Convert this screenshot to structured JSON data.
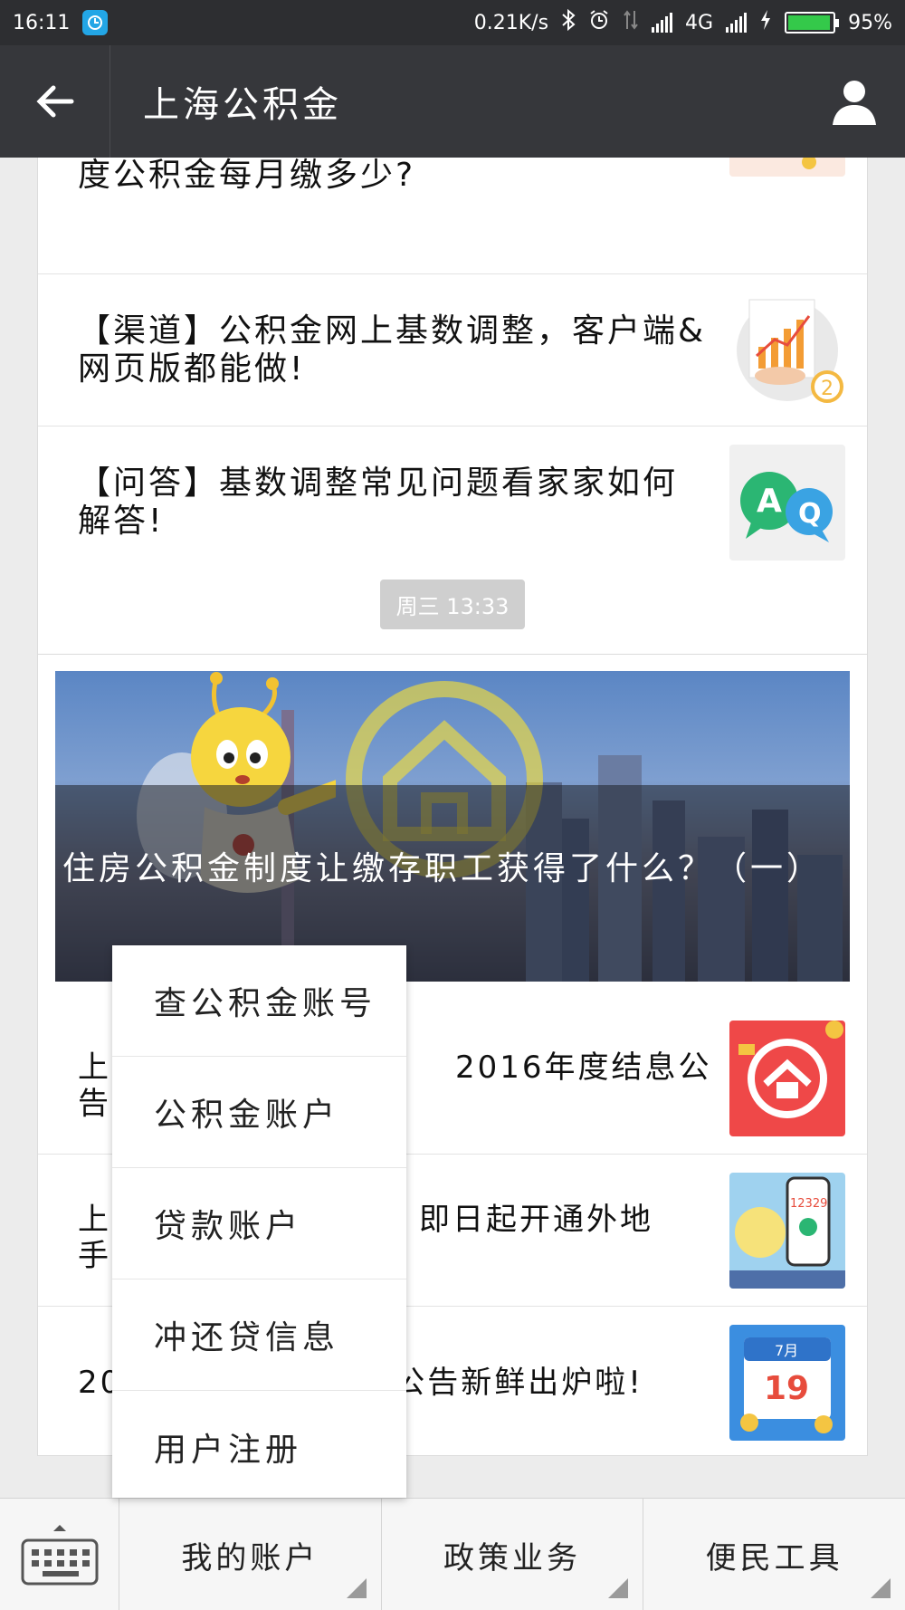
{
  "status_bar": {
    "time": "16:11",
    "network_speed": "0.21K/s",
    "network_type": "4G",
    "battery_percent": "95%",
    "battery_level": 0.95
  },
  "header": {
    "title": "上海公积金",
    "back_icon": "arrow-left-icon",
    "profile_icon": "user-icon"
  },
  "articles_top": [
    {
      "title": "度公积金每月缴多少?",
      "thumb_icon": "money-bag-icon"
    },
    {
      "title": "【渠道】公积金网上基数调整，客户端&网页版都能做!",
      "thumb_icon": "chart-icon",
      "badge": "2"
    },
    {
      "title": "【问答】基数调整常见问题看家家如何解答!",
      "thumb_icon": "qa-icon",
      "thumb_a": "A",
      "thumb_q": "Q"
    }
  ],
  "timestamp": "周三 13:33",
  "hero": {
    "title": "住房公积金制度让缴存职工获得了什么？（一）"
  },
  "articles_bottom": [
    {
      "title_left": "上",
      "title_right": "2016年度结息公",
      "title_left2": "告",
      "thumb_icon": "house-icon"
    },
    {
      "title_left": "上",
      "title_right": "即日起开通外地",
      "title_left2": "手",
      "thumb_icon": "phone-icon",
      "thumb_number": "12329"
    },
    {
      "title_left": "20",
      "title_right": "公告新鲜出炉啦!",
      "thumb_icon": "calendar-icon",
      "thumb_month": "7月",
      "thumb_day": "19"
    }
  ],
  "popup_menu": [
    "查公积金账号",
    "公积金账户",
    "贷款账户",
    "冲还贷信息",
    "用户注册"
  ],
  "bottom_menu": {
    "keyboard_icon": "keyboard-icon",
    "tabs": [
      "我的账户",
      "政策业务",
      "便民工具"
    ]
  },
  "colors": {
    "title_bar": "#36373b",
    "status_bar": "#2d2e31",
    "background": "#ececec"
  }
}
